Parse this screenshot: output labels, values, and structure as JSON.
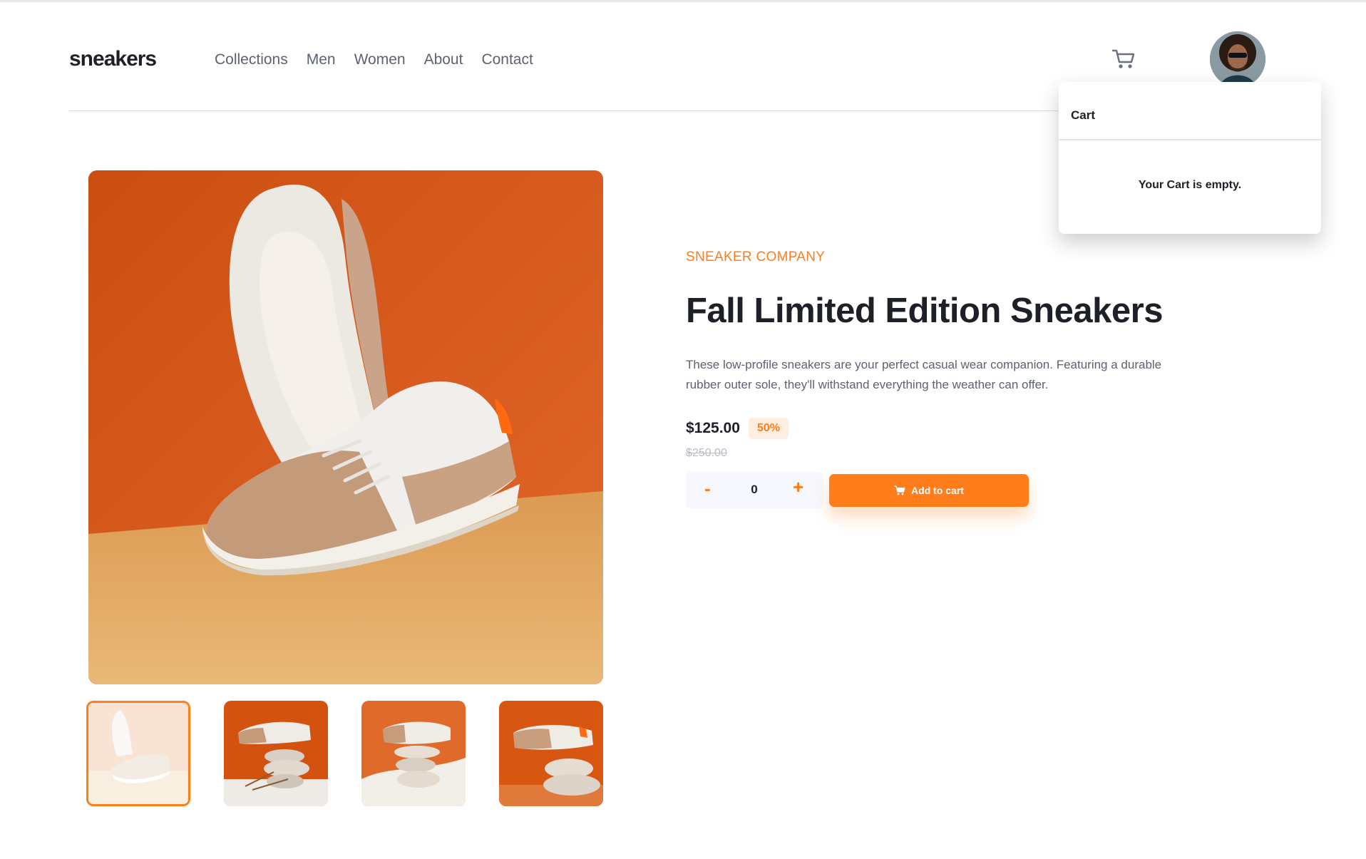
{
  "brand": {
    "logo": "sneakers"
  },
  "nav": {
    "items": [
      {
        "label": "Collections"
      },
      {
        "label": "Men"
      },
      {
        "label": "Women"
      },
      {
        "label": "About"
      },
      {
        "label": "Contact"
      }
    ]
  },
  "header": {
    "cart_icon": "cart-icon",
    "avatar": "user-avatar"
  },
  "cart": {
    "title": "Cart",
    "empty_message": "Your Cart is empty."
  },
  "product": {
    "company": "SNEAKER COMPANY",
    "title": "Fall Limited Edition Sneakers",
    "description": "These low-profile sneakers are your perfect casual wear companion. Featuring a durable rubber outer sole, they'll withstand everything the weather can offer.",
    "price": "$125.00",
    "discount": "50%",
    "original_price": "$250.00"
  },
  "quantity": {
    "minus_label": "-",
    "value": "0",
    "plus_label": "+"
  },
  "add_to_cart": {
    "label": "Add to cart",
    "icon": "cart-icon"
  },
  "gallery": {
    "selected_index": 0,
    "thumbnails": [
      {
        "name": "thumbnail-1"
      },
      {
        "name": "thumbnail-2"
      },
      {
        "name": "thumbnail-3"
      },
      {
        "name": "thumbnail-4"
      }
    ]
  },
  "colors": {
    "accent": "#ff7d1b",
    "accent_pale": "#ffeee2",
    "text_dark": "#1d2026",
    "text_muted": "#5d6270"
  }
}
